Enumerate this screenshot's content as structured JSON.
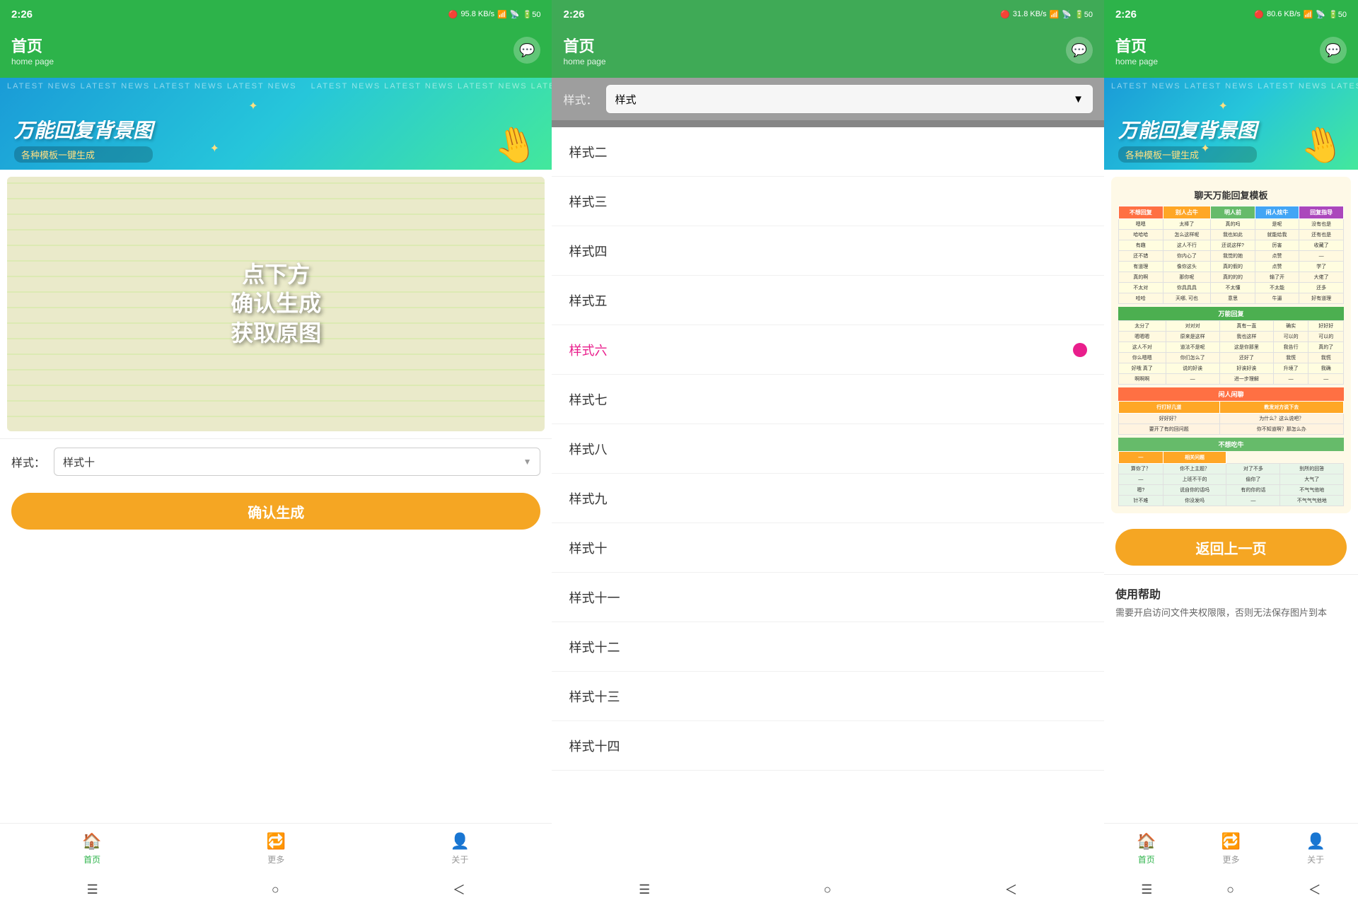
{
  "app": {
    "title": "首页",
    "subtitle": "home page",
    "time": "2:26",
    "message_icon": "💬"
  },
  "banner": {
    "ticker": "LATEST NEWS  LATEST NEWS  LATEST NEWS  LATEST NEWS",
    "main_text": "万能回复背景图",
    "sub_text": "各种模板一键生成"
  },
  "preview": {
    "overlay_line1": "点下方",
    "overlay_line2": "确认生成",
    "overlay_line3": "获取原图"
  },
  "style_selector": {
    "label": "样式：",
    "selected_value": "样式十"
  },
  "buttons": {
    "confirm": "确认生成",
    "back": "返回上一页"
  },
  "nav": {
    "home": "首页",
    "more": "更多",
    "about": "关于"
  },
  "dropdown": {
    "items": [
      {
        "label": "样式二",
        "selected": false
      },
      {
        "label": "样式三",
        "selected": false
      },
      {
        "label": "样式四",
        "selected": false
      },
      {
        "label": "样式五",
        "selected": false
      },
      {
        "label": "样式六",
        "selected": true
      },
      {
        "label": "样式七",
        "selected": false
      },
      {
        "label": "样式八",
        "selected": false
      },
      {
        "label": "样式九",
        "selected": false
      },
      {
        "label": "样式十",
        "selected": false
      },
      {
        "label": "样式十一",
        "selected": false
      },
      {
        "label": "样式十二",
        "selected": false
      },
      {
        "label": "样式十三",
        "selected": false
      },
      {
        "label": "样式十四",
        "selected": false
      }
    ]
  },
  "right_panel": {
    "table_title": "聊天万能回复模板",
    "help_title": "使用帮助",
    "help_text": "需要开启访问文件夹权限限，否则无法保存图片到本"
  },
  "status": {
    "wifi": "WiFi",
    "battery": "50",
    "signal": "5G"
  }
}
